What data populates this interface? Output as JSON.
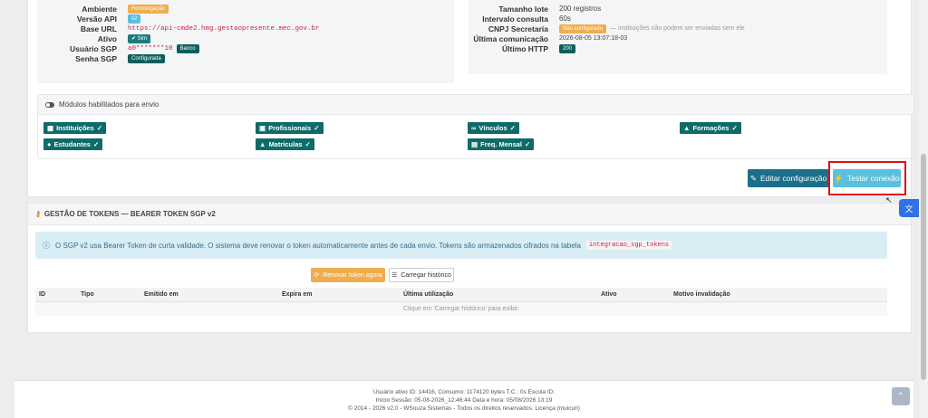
{
  "connection": {
    "left": [
      {
        "key": "Ambiente",
        "badge": "Homologação",
        "badge_color": "#f0ad4e"
      },
      {
        "key": "Versão API",
        "badge": "v2",
        "badge_color": "#5bc0de"
      },
      {
        "key": "Base URL",
        "link": "https://api-cmde2.hmg.gestaopresente.mec.gov.br"
      },
      {
        "key": "Ativo",
        "badge": "✔ Sim",
        "badge_color": "#1c7c7d"
      },
      {
        "key": "Usuário SGP",
        "value": "a0*******10",
        "badge": "Banco",
        "badge_color": "#0e5e5c"
      },
      {
        "key": "Senha SGP",
        "badge": "Configurada",
        "badge_color": "#0e5e5c"
      }
    ],
    "right": [
      {
        "key": "Tamanho lote",
        "value": "200 registros"
      },
      {
        "key": "Intervalo consulta",
        "value": "60s"
      },
      {
        "key": "CNPJ Secretaria",
        "badge": "Não configurado",
        "badge_color": "#f0ad4e",
        "note": "— instituições não podem ser enviadas sem ele"
      },
      {
        "key": "Última comunicação",
        "value": "2026-08-05 13:07:18-03"
      },
      {
        "key": "Último HTTP",
        "badge": "200",
        "badge_color": "#0e5e5c"
      }
    ]
  },
  "modules": {
    "title": "Módulos habilitados para envio",
    "items": [
      {
        "label": "Instituições",
        "icon": "building-icon"
      },
      {
        "label": "Estudantes",
        "icon": "user-icon"
      },
      {
        "label": "Profissionais",
        "icon": "briefcase-icon"
      },
      {
        "label": "Matrículas",
        "icon": "graduation-cap-icon"
      },
      {
        "label": "Vínculos",
        "icon": "link-icon"
      },
      {
        "label": "Freq. Mensal",
        "icon": "calendar-icon"
      },
      {
        "label": "Formações",
        "icon": "graduation-cap-icon"
      }
    ]
  },
  "actions": {
    "edit_label": "Editar configuração",
    "test_label": "Testar conexão"
  },
  "tokens": {
    "title": "GESTÃO DE TOKENS — BEARER TOKEN SGP v2",
    "alert_text": "O SGP v2 usa Bearer Token de curta validade. O sistema deve renovar o token automaticamente antes de cada envio. Tokens são armazenados cifrados na tabela",
    "alert_code": "integracao_sgp_tokens",
    "renew_label": "Renovar token agora",
    "history_label": "Carregar histórico",
    "columns": [
      "ID",
      "Tipo",
      "Emitido em",
      "Expira em",
      "Última utilização",
      "Ativo",
      "Motivo invalidação"
    ],
    "empty_text": "Clique em 'Carregar histórico' para exibir."
  },
  "footer": {
    "line1": "Usuário ativo ID: 14416, Consumo: 1174120 bytes T.C.: 0s Escola ID:",
    "line2": "Início Sessão: 05-08-2026_12:46:44 Data e hora: 05/08/2026 13:19",
    "line3": "© 2014 - 2026 v2.0 - WSouza Sistemas - Todos os direitos reservados. Licença (muicuri)"
  }
}
